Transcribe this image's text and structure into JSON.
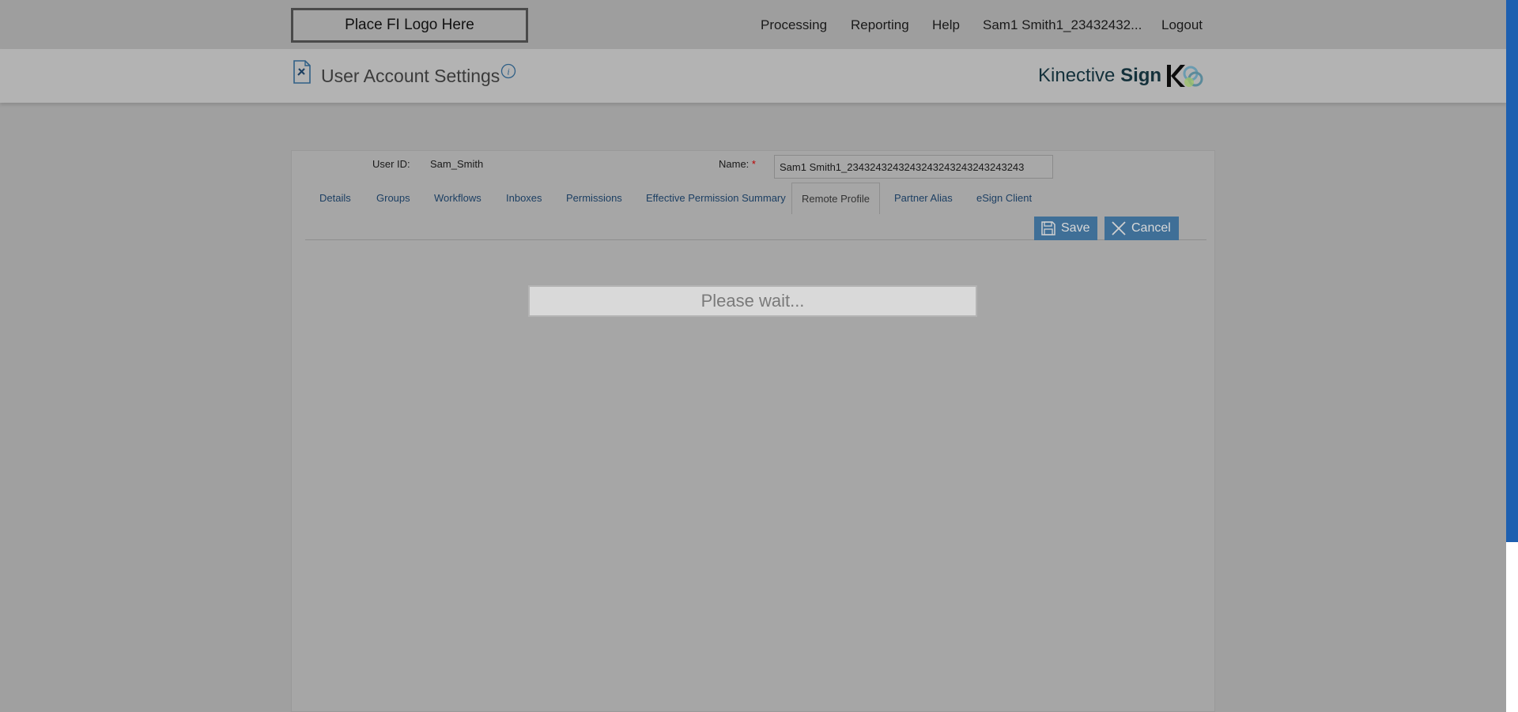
{
  "topbar": {
    "logo_text": "Place FI Logo Here",
    "nav": {
      "processing": "Processing",
      "reporting": "Reporting",
      "help": "Help",
      "user": "Sam1 Smith1_23432432...",
      "logout": "Logout"
    }
  },
  "header": {
    "title": "User Account Settings",
    "page_icon": "settings-document-icon",
    "info_icon": "info-icon",
    "brand_regular": "Kinective",
    "brand_bold": "Sign",
    "brand_logo": "k-logo-icon"
  },
  "form": {
    "user_id_label": "User ID:",
    "user_id_value": "Sam_Smith",
    "name_label": "Name:",
    "name_required": "*",
    "name_value": "Sam1 Smith1_2343243243243243243243243243243"
  },
  "tabs": [
    {
      "label": "Details"
    },
    {
      "label": "Groups"
    },
    {
      "label": "Workflows"
    },
    {
      "label": "Inboxes"
    },
    {
      "label": "Permissions"
    },
    {
      "label": "Effective Permission Summary"
    },
    {
      "label": "Remote Profile",
      "active": true
    },
    {
      "label": "Partner Alias"
    },
    {
      "label": "eSign Client"
    }
  ],
  "actions": {
    "save_label": "Save",
    "cancel_label": "Cancel"
  },
  "loading": {
    "message": "Please wait..."
  },
  "colors": {
    "overlay_bg": "#a0a0a0",
    "button_bg": "#3f6f97",
    "tab_text": "#1c3f63",
    "scrollbar": "#1d5fb0"
  }
}
